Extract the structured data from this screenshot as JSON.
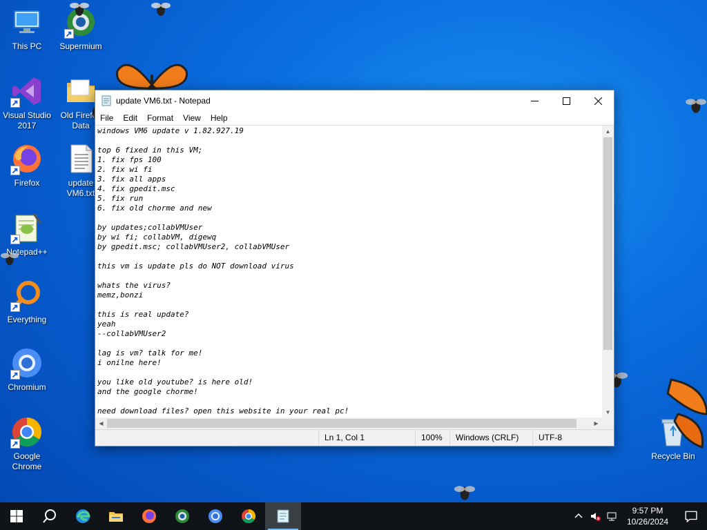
{
  "desktop": {
    "icons": [
      {
        "label": "This PC"
      },
      {
        "label": "Supermium"
      },
      {
        "label": "Visual Studio 2017"
      },
      {
        "label": "Old Firefox Data"
      },
      {
        "label": "Firefox"
      },
      {
        "label": "update VM6.txt"
      },
      {
        "label": "Notepad++"
      },
      {
        "label": "Everything"
      },
      {
        "label": "Chromium"
      },
      {
        "label": "Google Chrome"
      },
      {
        "label": "Recycle Bin"
      }
    ]
  },
  "notepad": {
    "title": "update VM6.txt - Notepad",
    "menu": [
      "File",
      "Edit",
      "Format",
      "View",
      "Help"
    ],
    "content": "windows VM6 update v 1.82.927.19\n\ntop 6 fixed in this VM;\n1. fix fps 100\n2. fix wi fi\n3. fix all apps\n4. fix gpedit.msc\n5. fix run\n6. fix old chorme and new\n\nby updates;collabVMUser\nby wi fi; collabVM, digewq\nby gpedit.msc; collabVMUser2, collabVMUser\n\nthis vm is update pls do NOT download virus\n\nwhats the virus?\nmemz,bonzi\n\nthis is real update?\nyeah\n--collabVMUser2\n\nlag is vm? talk for me!\ni onilne here!\n\nyou like old youtube? is here old!\nand the google chorme!\n\nneed download files? open this website in your real pc!\ndns.gg",
    "status": {
      "position": "Ln 1, Col 1",
      "zoom": "100%",
      "line_endings": "Windows (CRLF)",
      "encoding": "UTF-8"
    }
  },
  "taskbar": {
    "items": [
      "start-icon",
      "search-icon",
      "edge-icon",
      "file-explorer-icon",
      "firefox-icon",
      "supermium-icon",
      "chromium-icon",
      "chrome-icon",
      "notepad-icon"
    ],
    "clock": {
      "time": "9:57 PM",
      "date": "10/26/2024"
    }
  },
  "colors": {
    "desktop_bg": "#0a6fe0",
    "taskbar_bg": "#101418",
    "accent": "#76b9ed"
  }
}
